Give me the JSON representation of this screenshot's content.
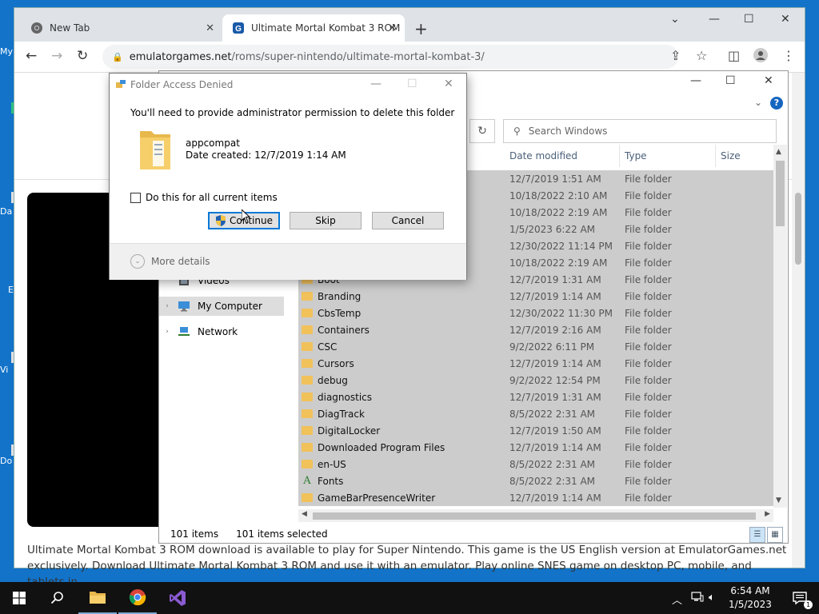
{
  "desktop": {
    "icon_labels": [
      "My",
      "Da",
      "E",
      "Vi",
      "Do"
    ]
  },
  "browser": {
    "tabs": [
      {
        "title": "New Tab"
      },
      {
        "title": "Ultimate Mortal Kombat 3 ROM"
      }
    ],
    "url_host": "emulatorgames.net",
    "url_path": "/roms/super-nintendo/ultimate-mortal-kombat-3/",
    "page_description": "Ultimate Mortal Kombat 3 ROM download is available to play for Super Nintendo. This game is the US English version at EmulatorGames.net exclusively. Download Ultimate Mortal Kombat 3 ROM and use it with an emulator. Play online SNES game on desktop PC, mobile, and tablets in"
  },
  "explorer": {
    "search_placeholder": "Search Windows",
    "columns": {
      "date": "Date modified",
      "type": "Type",
      "size": "Size"
    },
    "nav": [
      {
        "label": "Videos"
      },
      {
        "label": "My Computer"
      },
      {
        "label": "Network"
      }
    ],
    "rows": [
      {
        "name": "",
        "date": "12/7/2019 1:51 AM",
        "type": "File folder"
      },
      {
        "name": "",
        "date": "10/18/2022 2:10 AM",
        "type": "File folder"
      },
      {
        "name": "",
        "date": "10/18/2022 2:19 AM",
        "type": "File folder"
      },
      {
        "name": "",
        "date": "1/5/2023 6:22 AM",
        "type": "File folder"
      },
      {
        "name": "",
        "date": "12/30/2022 11:14 PM",
        "type": "File folder"
      },
      {
        "name": "",
        "date": "10/18/2022 2:19 AM",
        "type": "File folder"
      },
      {
        "name": "Boot",
        "date": "12/7/2019 1:31 AM",
        "type": "File folder"
      },
      {
        "name": "Branding",
        "date": "12/7/2019 1:14 AM",
        "type": "File folder"
      },
      {
        "name": "CbsTemp",
        "date": "12/30/2022 11:30 PM",
        "type": "File folder"
      },
      {
        "name": "Containers",
        "date": "12/7/2019 2:16 AM",
        "type": "File folder"
      },
      {
        "name": "CSC",
        "date": "9/2/2022 6:11 PM",
        "type": "File folder"
      },
      {
        "name": "Cursors",
        "date": "12/7/2019 1:14 AM",
        "type": "File folder"
      },
      {
        "name": "debug",
        "date": "9/2/2022 12:54 PM",
        "type": "File folder"
      },
      {
        "name": "diagnostics",
        "date": "12/7/2019 1:31 AM",
        "type": "File folder"
      },
      {
        "name": "DiagTrack",
        "date": "8/5/2022 2:31 AM",
        "type": "File folder"
      },
      {
        "name": "DigitalLocker",
        "date": "12/7/2019 1:50 AM",
        "type": "File folder"
      },
      {
        "name": "Downloaded Program Files",
        "date": "12/7/2019 1:14 AM",
        "type": "File folder"
      },
      {
        "name": "en-US",
        "date": "8/5/2022 2:31 AM",
        "type": "File folder"
      },
      {
        "name": "Fonts",
        "date": "8/5/2022 2:31 AM",
        "type": "File folder"
      },
      {
        "name": "GameBarPresenceWriter",
        "date": "12/7/2019 1:14 AM",
        "type": "File folder"
      }
    ],
    "status_items": "101 items",
    "status_selected": "101 items selected"
  },
  "dialog": {
    "title": "Folder Access Denied",
    "message": "You'll need to provide administrator permission to delete this folder",
    "folder_name": "appcompat",
    "date_created": "Date created: 12/7/2019 1:14 AM",
    "checkbox_label": "Do this for all current items",
    "buttons": {
      "continue": "Continue",
      "skip": "Skip",
      "cancel": "Cancel"
    },
    "more_details": "More details"
  },
  "taskbar": {
    "time": "6:54 AM",
    "date": "1/5/2023",
    "notification_count": "1"
  },
  "colors": {
    "desktop": "#1273c9",
    "selection": "#cccccc",
    "accent": "#0078d7"
  }
}
